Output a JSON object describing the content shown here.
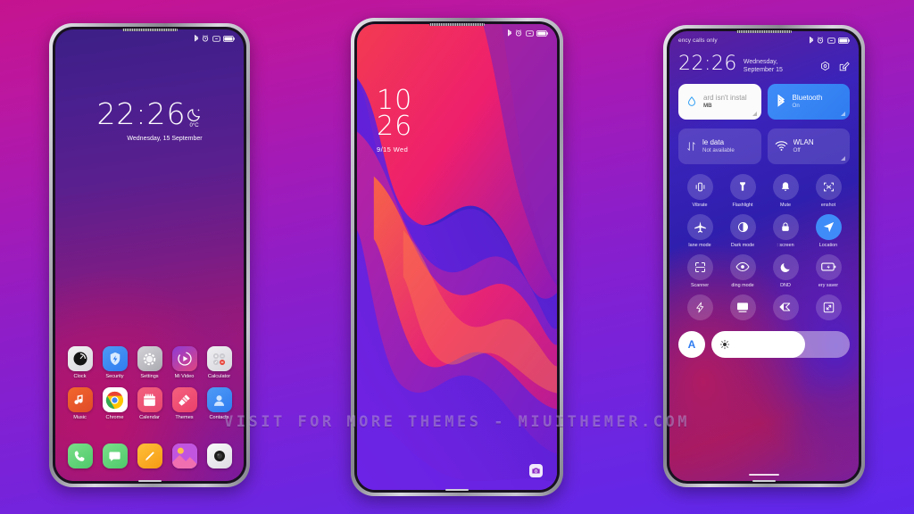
{
  "watermark": "VISIT FOR MORE THEMES - MIUITHEMER.COM",
  "background": {
    "top_color": "#c5138f",
    "bottom_color": "#5f27ec"
  },
  "phones": {
    "left": {
      "name": "lockscreen-home",
      "statusbar": {
        "carrier": "",
        "icons": [
          "bluetooth-icon",
          "alarm-icon",
          "dnd-icon",
          "battery-icon"
        ]
      },
      "clock": {
        "time": "22:26",
        "date": "Wednesday, 15 September",
        "weather_icon": "moon-icon",
        "temperature": "0°C"
      },
      "apps": [
        {
          "label": "Clock",
          "icon": "clock-icon"
        },
        {
          "label": "Security",
          "icon": "shield-icon"
        },
        {
          "label": "Settings",
          "icon": "gear-icon"
        },
        {
          "label": "Mi Video",
          "icon": "play-icon"
        },
        {
          "label": "Calculator",
          "icon": "calculator-icon"
        },
        {
          "label": "Music",
          "icon": "music-note-icon"
        },
        {
          "label": "Chrome",
          "icon": "chrome-icon"
        },
        {
          "label": "Calendar",
          "icon": "calendar-icon"
        },
        {
          "label": "Themes",
          "icon": "paintbrush-icon"
        },
        {
          "label": "Contacts",
          "icon": "person-icon"
        }
      ],
      "dock": [
        {
          "label": "Phone",
          "icon": "phone-icon"
        },
        {
          "label": "Messages",
          "icon": "message-icon"
        },
        {
          "label": "Notes",
          "icon": "pencil-icon"
        },
        {
          "label": "Gallery",
          "icon": "gallery-icon"
        },
        {
          "label": "Camera",
          "icon": "camera-icon"
        }
      ]
    },
    "center": {
      "name": "lockscreen-wallpaper",
      "statusbar": {
        "carrier": "",
        "icons": [
          "bluetooth-icon",
          "alarm-icon",
          "dnd-icon",
          "battery-icon"
        ]
      },
      "clock": {
        "hour": "10",
        "minute": "26",
        "date": "9/15  Wed"
      },
      "camera_shortcut": "camera-icon"
    },
    "right": {
      "name": "notification-shade",
      "statusbar": {
        "carrier": "ency calls only",
        "icons": [
          "bluetooth-icon",
          "alarm-icon",
          "dnd-icon",
          "battery-icon"
        ]
      },
      "header": {
        "time": "22:26",
        "date_line1": "Wednesday,",
        "date_line2": "September 15",
        "actions": [
          "settings-gear-icon",
          "edit-icon"
        ]
      },
      "big_tiles": [
        {
          "title": "ard isn't instal",
          "subtitle": "MB",
          "state": "white",
          "icon": "water-drop-icon"
        },
        {
          "title": "Bluetooth",
          "subtitle": "On",
          "state": "on",
          "icon": "bluetooth-icon"
        },
        {
          "title": "le data",
          "subtitle": "Not available",
          "state": "dim",
          "icon": "data-transfer-icon"
        },
        {
          "title": "WLAN",
          "subtitle": "Off",
          "state": "dim",
          "icon": "wifi-icon"
        }
      ],
      "toggles": [
        {
          "label": "Vibrate",
          "icon": "vibrate-icon",
          "active": false
        },
        {
          "label": "Flashlight",
          "icon": "flashlight-icon",
          "active": false
        },
        {
          "label": "Mute",
          "icon": "bell-icon",
          "active": false
        },
        {
          "label": "enshot",
          "icon": "screenshot-icon",
          "active": false
        },
        {
          "label": "lane mode",
          "icon": "airplane-icon",
          "active": false
        },
        {
          "label": "Dark mode",
          "icon": "contrast-icon",
          "active": false
        },
        {
          "label": ": screen",
          "icon": "lock-icon",
          "active": false
        },
        {
          "label": "Location",
          "icon": "location-icon",
          "active": true
        },
        {
          "label": "Scanner",
          "icon": "scanner-icon",
          "active": false
        },
        {
          "label": "ding mode",
          "icon": "eye-icon",
          "active": false
        },
        {
          "label": "DND",
          "icon": "moon-icon",
          "active": false
        },
        {
          "label": "ery saver",
          "icon": "battery-saver-icon",
          "active": false
        },
        {
          "label": "",
          "icon": "lightning-icon",
          "active": false
        },
        {
          "label": "",
          "icon": "cast-icon",
          "active": false
        },
        {
          "label": "",
          "icon": "color-mode-icon",
          "active": false
        },
        {
          "label": "",
          "icon": "resize-icon",
          "active": false
        }
      ],
      "brightness": {
        "auto_label": "A",
        "level_percent": 68,
        "icon": "brightness-icon"
      }
    }
  }
}
